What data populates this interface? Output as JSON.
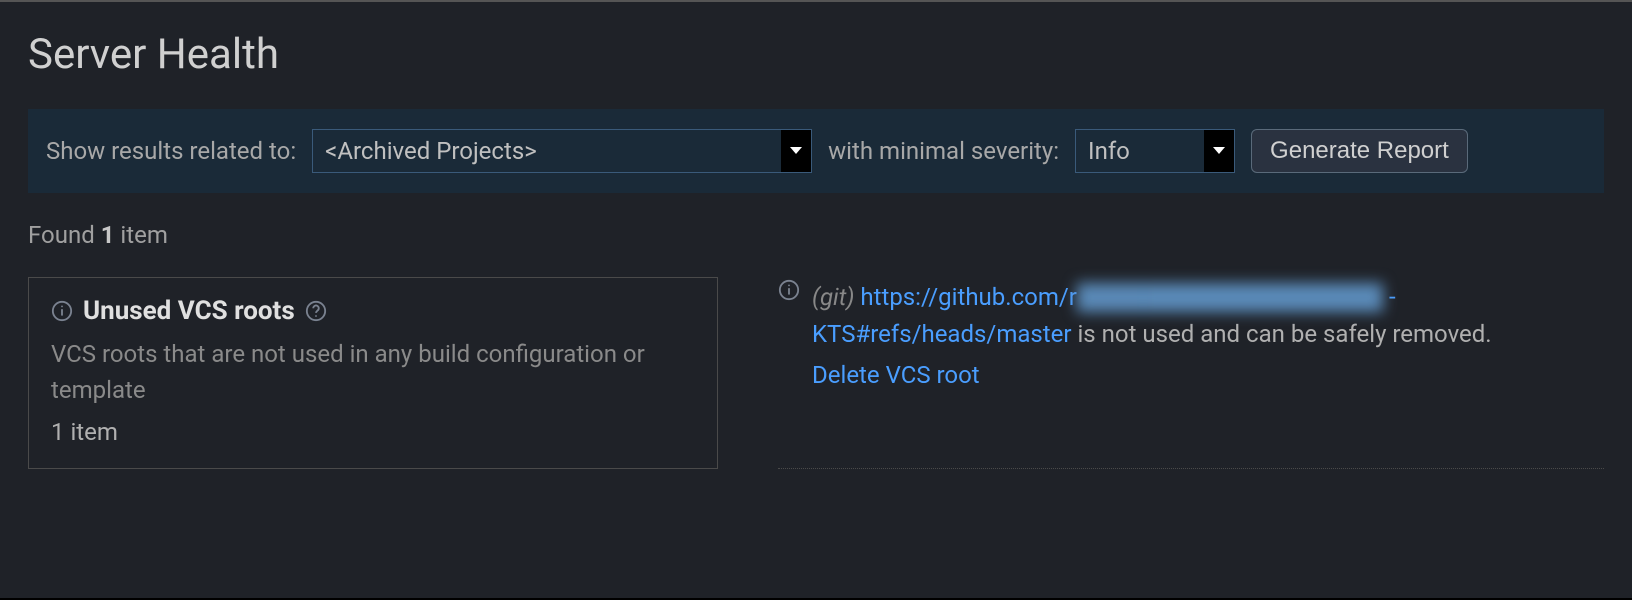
{
  "page": {
    "title": "Server Health"
  },
  "filter": {
    "results_label": "Show results related to:",
    "project_value": "<Archived Projects>",
    "severity_label": "with minimal severity:",
    "severity_value": "Info",
    "generate_button": "Generate Report"
  },
  "results": {
    "found_prefix": "Found ",
    "count": "1",
    "found_suffix": " item"
  },
  "card": {
    "title": "Unused VCS roots",
    "description": "VCS roots that are not used in any build configuration or template",
    "item_count": "1 item"
  },
  "detail": {
    "vcs_type": "(git)",
    "url_prefix": "https://github.com/r",
    "url_blurred": "██████████████████",
    "url_sep": " - ",
    "url_ref": "KTS#refs/heads/master",
    "message": " is not used and can be safely removed.",
    "delete_action": "Delete VCS root"
  }
}
